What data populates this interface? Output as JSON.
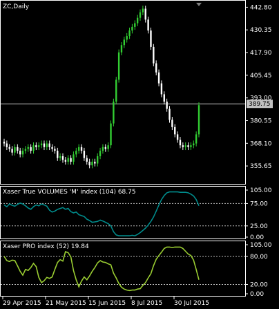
{
  "chart_data": [
    {
      "panel": "price",
      "type": "candlestick",
      "title": "ZC,Daily",
      "ylim": [
        346.2,
        446.0
      ],
      "y_ticks": [
        "442.80",
        "430.35",
        "417.90",
        "405.45",
        "393.00",
        "380.55",
        "368.10",
        "355.65"
      ],
      "current_price_label": "389.75",
      "current_price": 389.75,
      "colors": {
        "bull": "#32cd32",
        "bear": "#ffffff",
        "frame": "#ffffff",
        "price_line": "#c0c0c0"
      },
      "closes": [
        368,
        366,
        365,
        363,
        366,
        364,
        362,
        364,
        365,
        366,
        364,
        367,
        366,
        367,
        368,
        366,
        368,
        366,
        365,
        364,
        360,
        361,
        359,
        358,
        360,
        358,
        362,
        364,
        366,
        364,
        360,
        358,
        356,
        358,
        357,
        361,
        364,
        366,
        365,
        367,
        379,
        391,
        403,
        418,
        422,
        425,
        427,
        430,
        432,
        434,
        437,
        440,
        442,
        436,
        430,
        421,
        412,
        407,
        401,
        395,
        391,
        387,
        381,
        377,
        373,
        370,
        367,
        366,
        367,
        366,
        367,
        368,
        373,
        389
      ]
    },
    {
      "panel": "volumes",
      "type": "line",
      "title": "Xaser True VOLUMES 'M' index (104) 68.75",
      "ylim": [
        0,
        105
      ],
      "y_ticks": [
        "105.00",
        "75.00",
        "25.00",
        "0.00"
      ],
      "levels": [
        75,
        25
      ],
      "color": "#008b8b",
      "values": [
        72,
        68,
        74,
        71,
        69,
        73,
        76,
        74,
        70,
        65,
        62,
        68,
        72,
        70,
        74,
        72,
        69,
        60,
        56,
        58,
        62,
        64,
        66,
        62,
        64,
        57,
        54,
        56,
        50,
        48,
        46,
        40,
        37,
        33,
        34,
        35,
        38,
        36,
        33,
        30,
        25,
        12,
        5,
        3,
        3,
        3,
        3,
        3,
        4,
        3,
        6,
        10,
        15,
        20,
        27,
        35,
        45,
        58,
        72,
        84,
        93,
        99,
        101,
        101,
        101,
        101,
        100,
        100,
        100,
        99,
        96,
        92,
        84,
        70
      ]
    },
    {
      "panel": "pro",
      "type": "line",
      "title": "Xaser PRO index (52) 19.84",
      "ylim": [
        0,
        105
      ],
      "y_ticks": [
        "105.00",
        "80.00",
        "20.00",
        "0.00"
      ],
      "levels": [
        80,
        20
      ],
      "color": "#9acd32",
      "values": [
        80,
        71,
        69,
        72,
        71,
        60,
        48,
        40,
        52,
        50,
        56,
        65,
        58,
        35,
        24,
        28,
        35,
        33,
        36,
        52,
        67,
        73,
        70,
        90,
        88,
        79,
        50,
        30,
        15,
        27,
        36,
        30,
        38,
        48,
        56,
        66,
        71,
        68,
        67,
        64,
        62,
        44,
        34,
        22,
        14,
        10,
        8,
        7,
        8,
        8,
        10,
        11,
        18,
        24,
        34,
        43,
        60,
        74,
        82,
        89,
        97,
        100,
        100,
        99,
        100,
        100,
        100,
        97,
        91,
        85,
        82,
        72,
        52,
        30
      ]
    }
  ],
  "x_axis_labels": [
    "29 Apr 2015",
    "21 May 2015",
    "15 Jun 2015",
    "8 Jul 2015",
    "30 Jul 2015"
  ]
}
